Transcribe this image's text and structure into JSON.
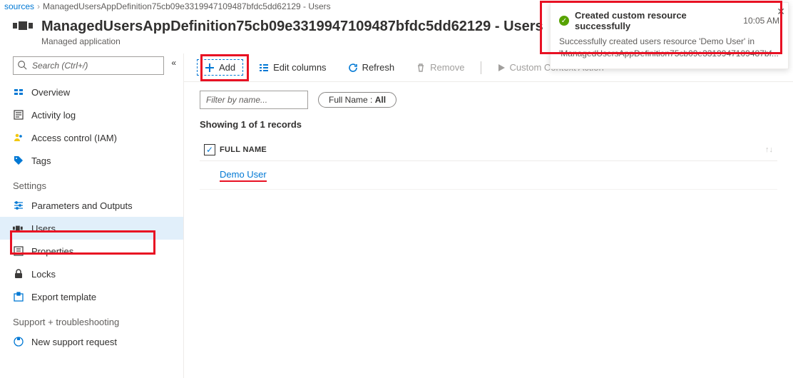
{
  "breadcrumb": {
    "root": "sources",
    "current": "ManagedUsersAppDefinition75cb09e3319947109487bfdc5dd62129 - Users"
  },
  "header": {
    "title": "ManagedUsersAppDefinition75cb09e3319947109487bfdc5dd62129 - Users",
    "subtitle": "Managed application"
  },
  "search": {
    "placeholder": "Search (Ctrl+/)"
  },
  "nav": {
    "items": [
      {
        "label": "Overview"
      },
      {
        "label": "Activity log"
      },
      {
        "label": "Access control (IAM)"
      },
      {
        "label": "Tags"
      }
    ],
    "settings_label": "Settings",
    "settings": [
      {
        "label": "Parameters and Outputs"
      },
      {
        "label": "Users"
      },
      {
        "label": "Properties"
      },
      {
        "label": "Locks"
      },
      {
        "label": "Export template"
      }
    ],
    "support_label": "Support + troubleshooting",
    "support": [
      {
        "label": "New support request"
      }
    ]
  },
  "toolbar": {
    "add": "Add",
    "edit_columns": "Edit columns",
    "refresh": "Refresh",
    "remove": "Remove",
    "custom": "Custom Context Action"
  },
  "filters": {
    "name_placeholder": "Filter by name...",
    "pill_label": "Full Name : ",
    "pill_value": "All"
  },
  "results": {
    "count_text": "Showing 1 of 1 records"
  },
  "table": {
    "columns": {
      "fullname": "FULL NAME"
    },
    "rows": [
      {
        "fullname": "Demo User"
      }
    ]
  },
  "toast": {
    "title": "Created custom resource successfully",
    "time": "10:05 AM",
    "body": "Successfully created users resource 'Demo User' in 'ManagedUsersAppDefinition75cb09e3319947109487bf..."
  }
}
